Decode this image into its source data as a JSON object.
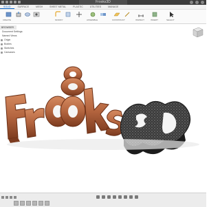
{
  "titlebar": {
    "document_title": "Frooks3D"
  },
  "ribbon_tabs": [
    "SOLID",
    "SURFACE",
    "MESH",
    "SHEET METAL",
    "PLASTIC",
    "UTILITIES",
    "MANAGE"
  ],
  "ribbon_groups": [
    "CREATE",
    "MODIFY",
    "ASSEMBLE",
    "CONSTRUCT",
    "INSPECT",
    "INSERT",
    "SELECT"
  ],
  "browser": {
    "header": "BROWSER",
    "items": [
      "Document Settings",
      "Named Views",
      "Origin",
      "Bodies",
      "Sketches",
      "Canvases"
    ]
  },
  "model_text": "Frooks3D",
  "colors": {
    "copper": "#b4653f",
    "carbon": "#3a3a3a",
    "accent": "#0a64c8"
  },
  "icons": [
    "new-component-icon",
    "extrude-icon",
    "revolve-icon",
    "hole-icon",
    "fillet-icon",
    "move-icon",
    "joint-icon",
    "plane-icon",
    "measure-icon",
    "insert-icon",
    "select-icon"
  ]
}
